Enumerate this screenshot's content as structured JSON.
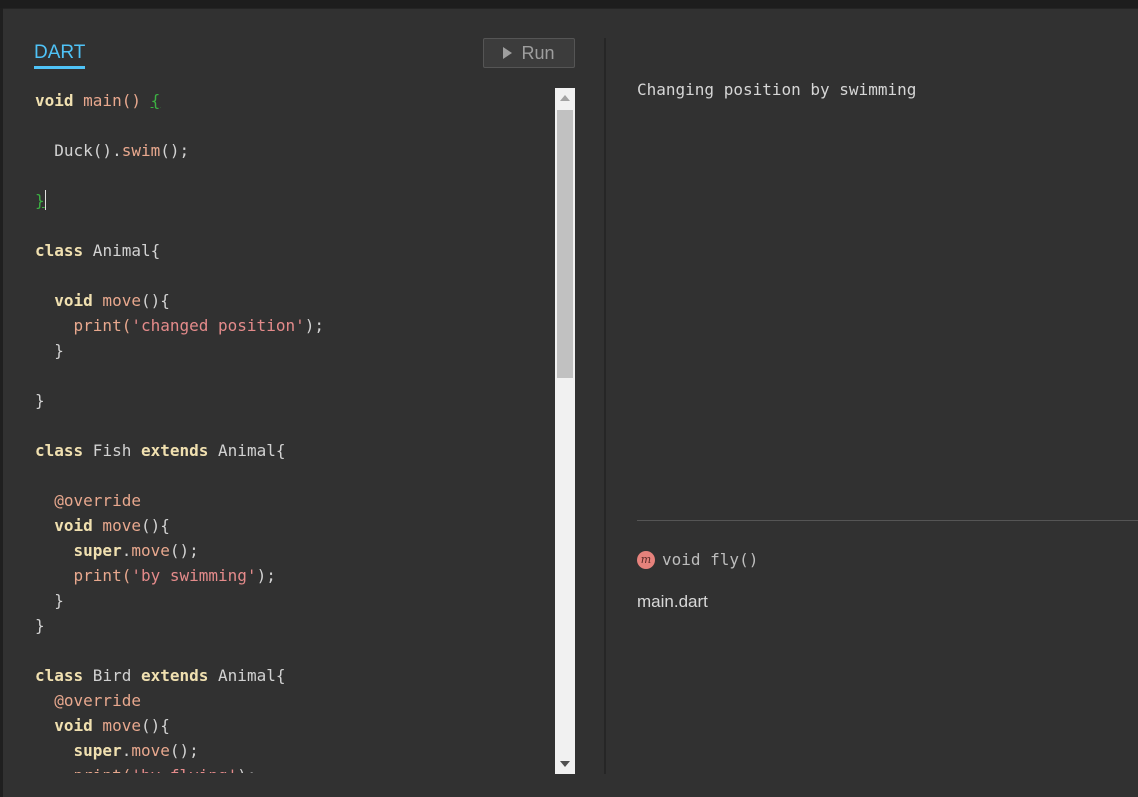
{
  "editor": {
    "tab_label": "DART",
    "run_label": "Run",
    "lines": [
      [
        {
          "t": "void",
          "c": "kw"
        },
        {
          "t": " main() ",
          "c": "fn"
        },
        {
          "t": "{",
          "c": "br"
        }
      ],
      [],
      [
        {
          "t": "  Duck()",
          "c": ""
        },
        {
          "t": ".",
          "c": ""
        },
        {
          "t": "swim",
          "c": "fn"
        },
        {
          "t": "();",
          "c": ""
        }
      ],
      [],
      [
        {
          "t": "}",
          "c": "br"
        },
        {
          "t": "",
          "c": "cursor"
        }
      ],
      [],
      [
        {
          "t": "class",
          "c": "kw"
        },
        {
          "t": " Animal{",
          "c": ""
        }
      ],
      [],
      [
        {
          "t": "  ",
          "c": ""
        },
        {
          "t": "void",
          "c": "kw"
        },
        {
          "t": " move",
          "c": "fn"
        },
        {
          "t": "(){",
          "c": ""
        }
      ],
      [
        {
          "t": "    print(",
          "c": "fn"
        },
        {
          "t": "'changed position'",
          "c": "str"
        },
        {
          "t": ");",
          "c": ""
        }
      ],
      [
        {
          "t": "  }",
          "c": ""
        }
      ],
      [],
      [
        {
          "t": "}",
          "c": ""
        }
      ],
      [],
      [
        {
          "t": "class",
          "c": "kw"
        },
        {
          "t": " Fish ",
          "c": ""
        },
        {
          "t": "extends",
          "c": "kw"
        },
        {
          "t": " Animal{",
          "c": ""
        }
      ],
      [],
      [
        {
          "t": "  @override",
          "c": "fn"
        }
      ],
      [
        {
          "t": "  ",
          "c": ""
        },
        {
          "t": "void",
          "c": "kw"
        },
        {
          "t": " move",
          "c": "fn"
        },
        {
          "t": "(){",
          "c": ""
        }
      ],
      [
        {
          "t": "    ",
          "c": ""
        },
        {
          "t": "super",
          "c": "kw"
        },
        {
          "t": ".",
          "c": ""
        },
        {
          "t": "move",
          "c": "fn"
        },
        {
          "t": "();",
          "c": ""
        }
      ],
      [
        {
          "t": "    print(",
          "c": "fn"
        },
        {
          "t": "'by swimming'",
          "c": "str"
        },
        {
          "t": ");",
          "c": ""
        }
      ],
      [
        {
          "t": "  }",
          "c": ""
        }
      ],
      [
        {
          "t": "}",
          "c": ""
        }
      ],
      [],
      [
        {
          "t": "class",
          "c": "kw"
        },
        {
          "t": " Bird ",
          "c": ""
        },
        {
          "t": "extends",
          "c": "kw"
        },
        {
          "t": " Animal{",
          "c": ""
        }
      ],
      [
        {
          "t": "  @override",
          "c": "fn"
        }
      ],
      [
        {
          "t": "  ",
          "c": ""
        },
        {
          "t": "void",
          "c": "kw"
        },
        {
          "t": " move",
          "c": "fn"
        },
        {
          "t": "(){",
          "c": ""
        }
      ],
      [
        {
          "t": "    ",
          "c": ""
        },
        {
          "t": "super",
          "c": "kw"
        },
        {
          "t": ".",
          "c": ""
        },
        {
          "t": "move",
          "c": "fn"
        },
        {
          "t": "();",
          "c": ""
        }
      ],
      [
        {
          "t": "    print(",
          "c": "fn"
        },
        {
          "t": "'by flying'",
          "c": "str"
        },
        {
          "t": ");",
          "c": ""
        }
      ]
    ]
  },
  "output": {
    "text": "Changing position by swimming"
  },
  "docs": {
    "icon_letter": "m",
    "signature": "void fly()",
    "library": "main.dart"
  },
  "colors": {
    "accent": "#4fc3f7",
    "background": "#313131",
    "keyword": "#f0e0b0",
    "function": "#e8a88e",
    "string": "#e58b8b",
    "bracket_match": "#3cb043"
  }
}
